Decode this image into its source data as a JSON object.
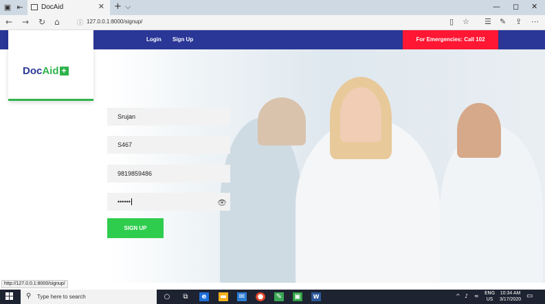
{
  "browser": {
    "tab_title": "DocAid",
    "tab_close": "✕",
    "new_tab": "+",
    "tab_menu": "⌵",
    "url": "127.0.0.1:8000/signup/",
    "window": {
      "minimize": "—",
      "maximize": "◻",
      "close": "✕"
    },
    "status_url": "http://127.0.0.1:8000/signup/"
  },
  "site": {
    "nav": {
      "login": "Login",
      "signup": "Sign Up"
    },
    "emergency": "For Emergencies: Call 102",
    "logo": {
      "doc": "Doc",
      "aid": "Aid",
      "plus": "+"
    }
  },
  "form": {
    "name_value": "Srujan",
    "id_value": "S467",
    "phone_value": "9819859486",
    "password_value": "••••••",
    "submit_label": "SIGN UP"
  },
  "taskbar": {
    "search_placeholder": "Type here to search",
    "lang": "ENG",
    "region": "US",
    "time": "10:34 AM",
    "date": "3/17/2020"
  },
  "colors": {
    "navbar": "#2a3797",
    "emergency": "#ff1733",
    "accent_green": "#2fcd4e"
  }
}
